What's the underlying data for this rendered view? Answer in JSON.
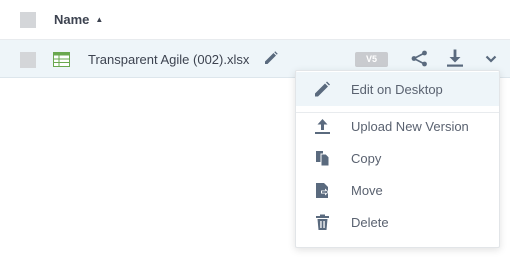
{
  "table": {
    "header": {
      "name_label": "Name",
      "sort_direction": "ascending"
    },
    "rows": [
      {
        "file_name": "Transparent Agile (002).xlsx",
        "version": "V5",
        "file_type": "xlsx"
      }
    ]
  },
  "menu": {
    "items": [
      {
        "label": "Edit on Desktop",
        "icon": "pencil-icon"
      },
      {
        "label": "Upload New Version",
        "icon": "upload-icon"
      },
      {
        "label": "Copy",
        "icon": "copy-icon"
      },
      {
        "label": "Move",
        "icon": "move-icon"
      },
      {
        "label": "Delete",
        "icon": "trash-icon"
      }
    ]
  },
  "colors": {
    "row_highlight": "#eef5f9",
    "icon_gray": "#5a6a7e",
    "excel_green": "#6aa84f"
  }
}
